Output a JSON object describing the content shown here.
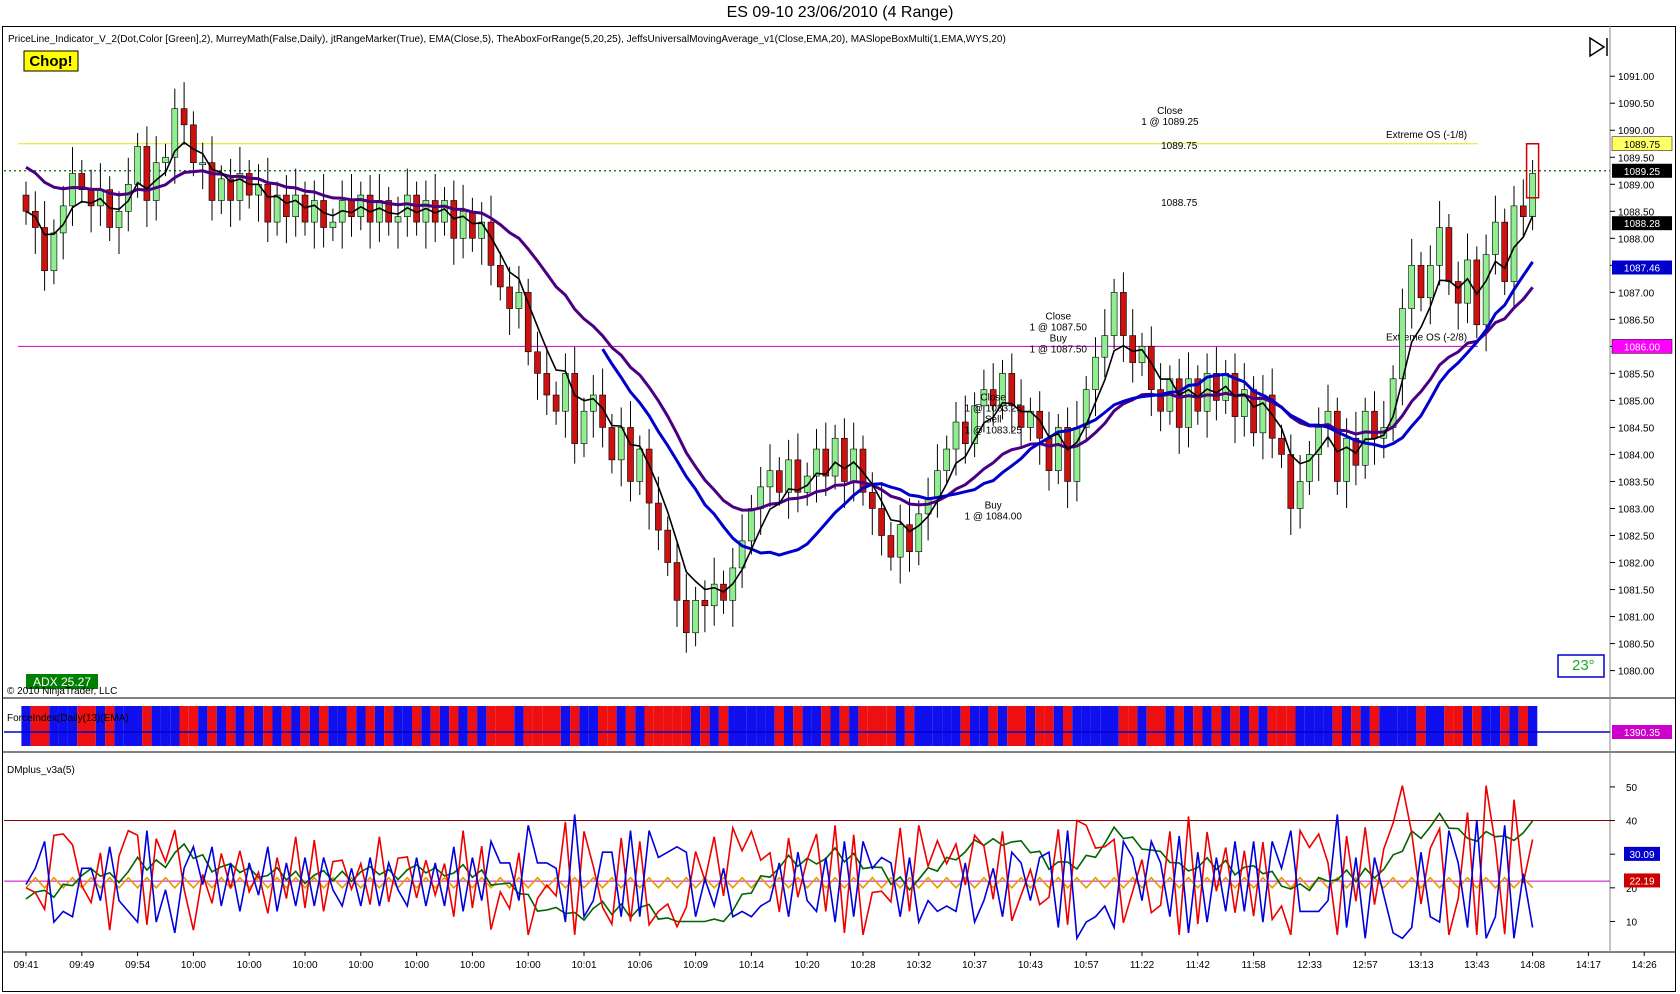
{
  "window": {
    "title": "ES 09-10  23/06/2010 (4 Range)"
  },
  "chart_header": {
    "indicators": "PriceLine_Indicator_V_2(Dot,Color [Green],2), MurreyMath(False,Daily), jtRangeMarker(True), EMA(Close,5), TheAboxForRange(5,20,25), JeffsUniversalMovingAverage_v1(Close,EMA,20), MASlopeBoxMulti(1,EMA,WYS,20)",
    "chop_label": "Chop!",
    "adx_label": "ADX 25.27",
    "angle_label": "23°",
    "copyright": "© 2010 NinjaTrader, LLC"
  },
  "colors": {
    "up_bar": "#90ee90",
    "down_bar": "#cc1111",
    "ema5": "#000000",
    "ema20": "#4b0082",
    "sma": "#0000cc",
    "yellow_level": "#e6e600",
    "magenta_level": "#cc00cc",
    "price_dot": "#006400"
  },
  "price_levels": [
    {
      "label": "Extreme OS (-1/8)",
      "value": 1089.75,
      "axis_label": "1089.75",
      "color": "#e6e600",
      "badge_bg": "#ffff66",
      "badge_fg": "#000000"
    },
    {
      "label": "Extreme OS (-2/8)",
      "value": 1086.0,
      "axis_label": "1086.00",
      "color": "#cc00cc",
      "badge_bg": "#ff00ff",
      "badge_fg": "#ffffff"
    }
  ],
  "axis_badges": [
    {
      "value": 1089.25,
      "label": "1089.25",
      "bg": "#000000",
      "fg": "#ffffff"
    },
    {
      "value": 1088.28,
      "label": "1088.28",
      "bg": "#000000",
      "fg": "#ffffff"
    },
    {
      "value": 1087.46,
      "label": "1087.46",
      "bg": "#0000cc",
      "fg": "#ffffff"
    }
  ],
  "trade_annotations": [
    {
      "lines": [
        "Close",
        "1 @ 1089.25"
      ],
      "bar": 123,
      "price": 1090.3
    },
    {
      "lines": [
        "1089.75"
      ],
      "bar": 124,
      "price": 1089.65
    },
    {
      "lines": [
        "1088.75"
      ],
      "bar": 124,
      "price": 1088.6
    },
    {
      "lines": [
        "Close",
        "1 @ 1087.50",
        "Buy",
        "1 @ 1087.50"
      ],
      "bar": 111,
      "price": 1086.5
    },
    {
      "lines": [
        "Close",
        "1 @ 1083.25",
        "Sell",
        "1 @ 1083.25"
      ],
      "bar": 104,
      "price": 1085.0
    },
    {
      "lines": [
        "Buy",
        "1 @ 1084.00"
      ],
      "bar": 104,
      "price": 1083.0
    }
  ],
  "force_panel": {
    "title": "ForceIndex(Daily(13)(EMA)",
    "axis_label": "1390.35"
  },
  "dm_panel": {
    "title": "DMplus_v3a(5)",
    "axis_ticks": [
      "50",
      "40",
      "30",
      "20",
      "10"
    ],
    "badges": [
      {
        "label": "30.09",
        "bg": "#0000cc"
      },
      {
        "label": "22.19",
        "bg": "#cc0000"
      }
    ],
    "ref_lines": [
      40,
      22
    ]
  },
  "chart_data": {
    "type": "candlestick",
    "title": "ES 09-10  23/06/2010 (4 Range)",
    "ylim": [
      1079.9,
      1091.3
    ],
    "y_ticks": [
      "1091.00",
      "1090.50",
      "1090.00",
      "1089.50",
      "1089.00",
      "1088.50",
      "1088.00",
      "1087.50",
      "1087.00",
      "1086.50",
      "1086.00",
      "1085.50",
      "1085.00",
      "1084.50",
      "1084.00",
      "1083.50",
      "1083.00",
      "1082.50",
      "1082.00",
      "1081.50",
      "1081.00",
      "1080.50",
      "1080.00"
    ],
    "x_ticks": [
      {
        "bar": 0,
        "label": "09:41"
      },
      {
        "bar": 6,
        "label": "09:49"
      },
      {
        "bar": 12,
        "label": "09:54"
      },
      {
        "bar": 18,
        "label": "10:00"
      },
      {
        "bar": 24,
        "label": "10:00"
      },
      {
        "bar": 30,
        "label": "10:00"
      },
      {
        "bar": 36,
        "label": "10:00"
      },
      {
        "bar": 42,
        "label": "10:00"
      },
      {
        "bar": 48,
        "label": "10:00"
      },
      {
        "bar": 54,
        "label": "10:00"
      },
      {
        "bar": 60,
        "label": "10:01"
      },
      {
        "bar": 66,
        "label": "10:06"
      },
      {
        "bar": 72,
        "label": "10:09"
      },
      {
        "bar": 78,
        "label": "10:14"
      },
      {
        "bar": 84,
        "label": "10:20"
      },
      {
        "bar": 90,
        "label": "10:28"
      },
      {
        "bar": 96,
        "label": "10:32"
      },
      {
        "bar": 102,
        "label": "10:37"
      },
      {
        "bar": 108,
        "label": "10:43"
      },
      {
        "bar": 114,
        "label": "10:57"
      },
      {
        "bar": 120,
        "label": "11:22"
      },
      {
        "bar": 126,
        "label": "11:42"
      },
      {
        "bar": 132,
        "label": "11:58"
      },
      {
        "bar": 138,
        "label": "12:33"
      },
      {
        "bar": 144,
        "label": "12:57"
      },
      {
        "bar": 150,
        "label": "13:13"
      },
      {
        "bar": 156,
        "label": "13:43"
      },
      {
        "bar": 162,
        "label": "14:08"
      },
      {
        "bar": 168,
        "label": "14:17"
      },
      {
        "bar": 174,
        "label": "14:26"
      }
    ],
    "bar_count": 163,
    "closes": [
      1088.5,
      1088.2,
      1087.4,
      1088.1,
      1088.6,
      1089.2,
      1088.9,
      1088.6,
      1088.9,
      1088.2,
      1088.5,
      1089.0,
      1089.7,
      1088.7,
      1089.4,
      1089.5,
      1090.4,
      1090.1,
      1089.4,
      1089.4,
      1088.7,
      1089.1,
      1088.7,
      1089.2,
      1088.8,
      1089.0,
      1088.3,
      1088.8,
      1088.4,
      1088.8,
      1088.3,
      1088.7,
      1088.2,
      1088.3,
      1088.7,
      1088.4,
      1088.8,
      1088.3,
      1088.7,
      1088.3,
      1088.4,
      1088.8,
      1088.3,
      1088.7,
      1088.3,
      1088.7,
      1088.0,
      1088.5,
      1088.0,
      1088.3,
      1087.5,
      1087.1,
      1086.7,
      1087.0,
      1085.9,
      1085.5,
      1085.1,
      1084.8,
      1085.5,
      1084.2,
      1084.8,
      1085.1,
      1084.5,
      1083.9,
      1084.5,
      1083.5,
      1084.1,
      1083.1,
      1082.6,
      1082.0,
      1081.3,
      1080.7,
      1081.3,
      1081.2,
      1081.6,
      1081.3,
      1081.9,
      1082.4,
      1083.0,
      1083.4,
      1083.7,
      1083.3,
      1083.9,
      1083.3,
      1083.6,
      1084.1,
      1083.6,
      1084.3,
      1083.5,
      1084.1,
      1083.3,
      1083.0,
      1082.5,
      1082.1,
      1082.7,
      1082.2,
      1082.9,
      1083.2,
      1083.7,
      1084.1,
      1084.6,
      1084.2,
      1084.9,
      1085.2,
      1084.9,
      1085.5,
      1084.9,
      1084.5,
      1084.8,
      1084.3,
      1083.7,
      1084.5,
      1083.5,
      1084.5,
      1085.2,
      1085.8,
      1086.2,
      1087.0,
      1086.2,
      1085.7,
      1086.0,
      1085.2,
      1084.8,
      1085.4,
      1084.5,
      1085.4,
      1084.8,
      1085.5,
      1085.0,
      1085.5,
      1084.7,
      1085.2,
      1084.4,
      1085.1,
      1084.3,
      1084.0,
      1083.0,
      1083.5,
      1084.0,
      1084.5,
      1084.8,
      1083.5,
      1084.3,
      1083.8,
      1084.8,
      1084.3,
      1084.5,
      1085.4,
      1086.7,
      1087.5,
      1086.9,
      1087.5,
      1088.2,
      1087.2,
      1086.8,
      1087.6,
      1086.4,
      1087.7,
      1088.3,
      1087.2,
      1088.6,
      1088.4,
      1089.2
    ]
  }
}
